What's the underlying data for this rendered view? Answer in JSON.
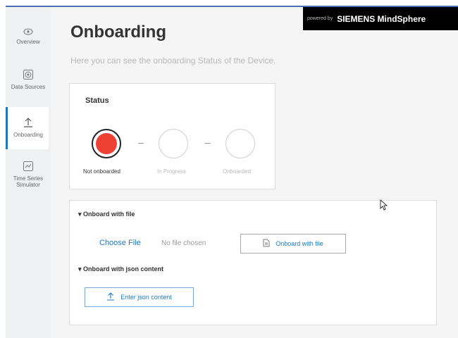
{
  "brand": {
    "powered_by": "powered by",
    "name": "SIEMENS MindSphere"
  },
  "sidebar": {
    "items": [
      {
        "label": "Overview",
        "icon": "eye-icon",
        "active": false
      },
      {
        "label": "Data Sources",
        "icon": "database-icon",
        "active": false
      },
      {
        "label": "Onboarding",
        "icon": "upload-icon",
        "active": true
      },
      {
        "label": "Time Series Simulator",
        "icon": "chart-icon",
        "active": false
      }
    ]
  },
  "page": {
    "title": "Onboarding",
    "subtitle": "Here you can see the onboarding Status of the Device."
  },
  "status": {
    "title": "Status",
    "steps": [
      {
        "label": "Not onboarded",
        "active": true
      },
      {
        "label": "In Progress",
        "active": false
      },
      {
        "label": "Onboarded",
        "active": false
      }
    ],
    "active_color": "#ef4035"
  },
  "onboard": {
    "file_section_title": "Onboard with file",
    "choose_file": "Choose File",
    "no_file": "No file chosen",
    "onboard_file_button": "Onboard with file",
    "json_section_title": "Onboard with json content",
    "enter_json_button": "Enter json content"
  },
  "colors": {
    "accent": "#1f78c1",
    "brand_bar": "#000000"
  }
}
